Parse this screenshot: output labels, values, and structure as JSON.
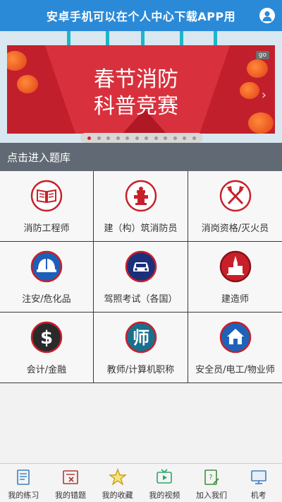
{
  "header": {
    "title": "安卓手机可以在个人中心下载APP用",
    "bg_color": "#2b8ad7"
  },
  "banner": {
    "line1": "春节消防",
    "line2": "科普竞赛",
    "badge": "go",
    "arrow": "›",
    "slide_count": 12,
    "active_slide": 1
  },
  "section": {
    "title": "点击进入题库"
  },
  "categories": [
    {
      "label": "消防工程师",
      "icon": "book-icon"
    },
    {
      "label": "建（构）筑消防员",
      "icon": "fire-hydrant-icon"
    },
    {
      "label": "消岗资格/灭火员",
      "icon": "axe-crossed-icon"
    },
    {
      "label": "注安/危化品",
      "icon": "safety-helmet-icon"
    },
    {
      "label": "驾照考试（各国）",
      "icon": "car-icon"
    },
    {
      "label": "建造师",
      "icon": "building-icon"
    },
    {
      "label": "会计/金融",
      "icon": "dollar-icon"
    },
    {
      "label": "教师/计算机职称",
      "icon": "teacher-icon"
    },
    {
      "label": "安全员/电工/物业师",
      "icon": "house-icon"
    }
  ],
  "bottom_nav": [
    {
      "label": "我的练习",
      "icon": "practice-icon"
    },
    {
      "label": "我的错题",
      "icon": "wrong-answers-icon"
    },
    {
      "label": "我的收藏",
      "icon": "star-icon"
    },
    {
      "label": "我的视频",
      "icon": "video-icon"
    },
    {
      "label": "加入我们",
      "icon": "join-icon"
    },
    {
      "label": "机考",
      "icon": "monitor-icon"
    }
  ]
}
